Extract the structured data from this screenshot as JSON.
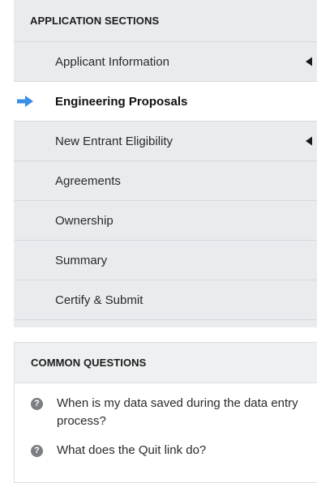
{
  "sections_panel": {
    "title": "APPLICATION SECTIONS",
    "items": [
      {
        "label": "Applicant Information",
        "expandable": true,
        "active": false
      },
      {
        "label": "Engineering Proposals",
        "expandable": false,
        "active": true
      },
      {
        "label": "New Entrant Eligibility",
        "expandable": true,
        "active": false
      },
      {
        "label": "Agreements",
        "expandable": false,
        "active": false
      },
      {
        "label": "Ownership",
        "expandable": false,
        "active": false
      },
      {
        "label": "Summary",
        "expandable": false,
        "active": false
      },
      {
        "label": "Certify & Submit",
        "expandable": false,
        "active": false
      }
    ]
  },
  "questions_panel": {
    "title": "COMMON QUESTIONS",
    "items": [
      {
        "label": "When is my data saved during the data entry process?",
        "icon": "help-icon"
      },
      {
        "label": "What does the Quit link do?",
        "icon": "help-icon"
      }
    ]
  },
  "colors": {
    "active_arrow": "#3a8ee6",
    "panel_bg": "#e9ebee",
    "help_icon_bg": "#7b7e82"
  }
}
